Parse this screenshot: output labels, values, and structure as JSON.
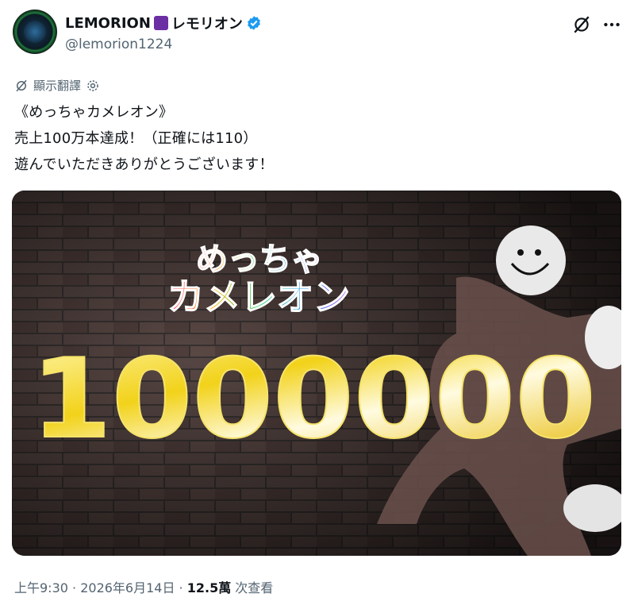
{
  "author": {
    "display_name": "LEMORION",
    "display_name_suffix": "レモリオン",
    "handle": "@lemorion1224",
    "verified": true
  },
  "translate": {
    "label": "顯示翻譯"
  },
  "tweet": {
    "lines": [
      "《めっちゃカメレオン》",
      "売上100万本達成！（正確には110）",
      "遊んでいただきありがとうございます！"
    ]
  },
  "media": {
    "logo_line1": "めっちゃ",
    "logo_line2": "カメレオン",
    "big_number": "1000000"
  },
  "meta": {
    "time": "上午9:30",
    "sep1": " · ",
    "date": "2026年6月14日",
    "sep2": " · ",
    "views": "12.5萬",
    "views_label": " 次查看"
  },
  "colors": {
    "accent": "#1d9bf0",
    "muted": "#536471",
    "text": "#0f1419"
  },
  "icons": [
    "verified-badge-icon",
    "grok-icon",
    "more-icon",
    "translate-icon",
    "gear-icon"
  ]
}
